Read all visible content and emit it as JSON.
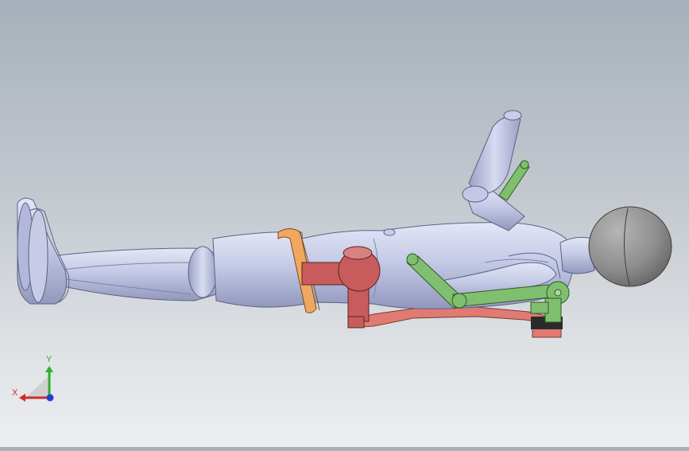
{
  "viewport": {
    "model": {
      "parts": [
        {
          "name": "head",
          "color": "#8e8e8e"
        },
        {
          "name": "body",
          "color": "#c2c7e4"
        },
        {
          "name": "brace-link",
          "color": "#7fbf6f"
        },
        {
          "name": "hip-joint",
          "color": "#c85c5c"
        },
        {
          "name": "strap",
          "color": "#f0a860"
        },
        {
          "name": "base-frame",
          "color": "#e07a72"
        }
      ]
    },
    "triad": {
      "x_label": "X",
      "y_label": "Y",
      "x_color": "#d12a2a",
      "y_color": "#2fae2f",
      "z_color": "#1e3fd6"
    }
  }
}
